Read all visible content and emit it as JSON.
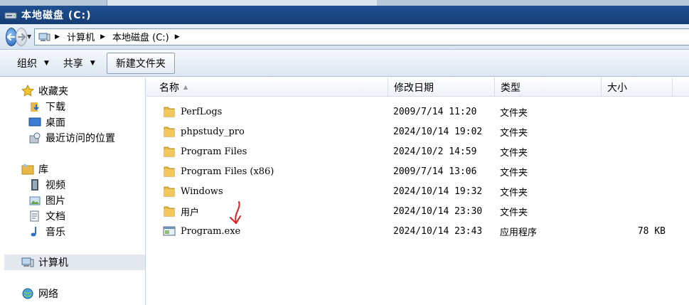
{
  "window": {
    "title": "本地磁盘 (C:)"
  },
  "address": {
    "crumbs": [
      "计算机",
      "本地磁盘 (C:)"
    ]
  },
  "toolbar": {
    "organize_label": "组织",
    "share_label": "共享",
    "new_folder_label": "新建文件夹"
  },
  "nav": {
    "favorites": {
      "label": "收藏夹",
      "items": [
        "下载",
        "桌面",
        "最近访问的位置"
      ]
    },
    "libraries": {
      "label": "库",
      "items": [
        "视频",
        "图片",
        "文档",
        "音乐"
      ]
    },
    "computer": "计算机",
    "network": "网络"
  },
  "columns": {
    "name": "名称",
    "date": "修改日期",
    "type": "类型",
    "size": "大小"
  },
  "files": [
    {
      "name": "PerfLogs",
      "date": "2009/7/14 11:20",
      "type": "文件夹",
      "size": "",
      "icon": "folder-icon"
    },
    {
      "name": "phpstudy_pro",
      "date": "2024/10/14 19:02",
      "type": "文件夹",
      "size": "",
      "icon": "folder-icon"
    },
    {
      "name": "Program Files",
      "date": "2024/10/2 14:59",
      "type": "文件夹",
      "size": "",
      "icon": "folder-icon"
    },
    {
      "name": "Program Files (x86)",
      "date": "2009/7/14 13:06",
      "type": "文件夹",
      "size": "",
      "icon": "folder-icon"
    },
    {
      "name": "Windows",
      "date": "2024/10/14 19:32",
      "type": "文件夹",
      "size": "",
      "icon": "folder-icon"
    },
    {
      "name": "用户",
      "date": "2024/10/14 23:30",
      "type": "文件夹",
      "size": "",
      "icon": "folder-icon"
    },
    {
      "name": "Program.exe",
      "date": "2024/10/14 23:43",
      "type": "应用程序",
      "size": "78 KB",
      "icon": "exe-icon"
    }
  ],
  "colors": {
    "title_bar": "#1f4f8f",
    "folder": "#e8b84a",
    "annotation_arrow": "#e02020"
  }
}
